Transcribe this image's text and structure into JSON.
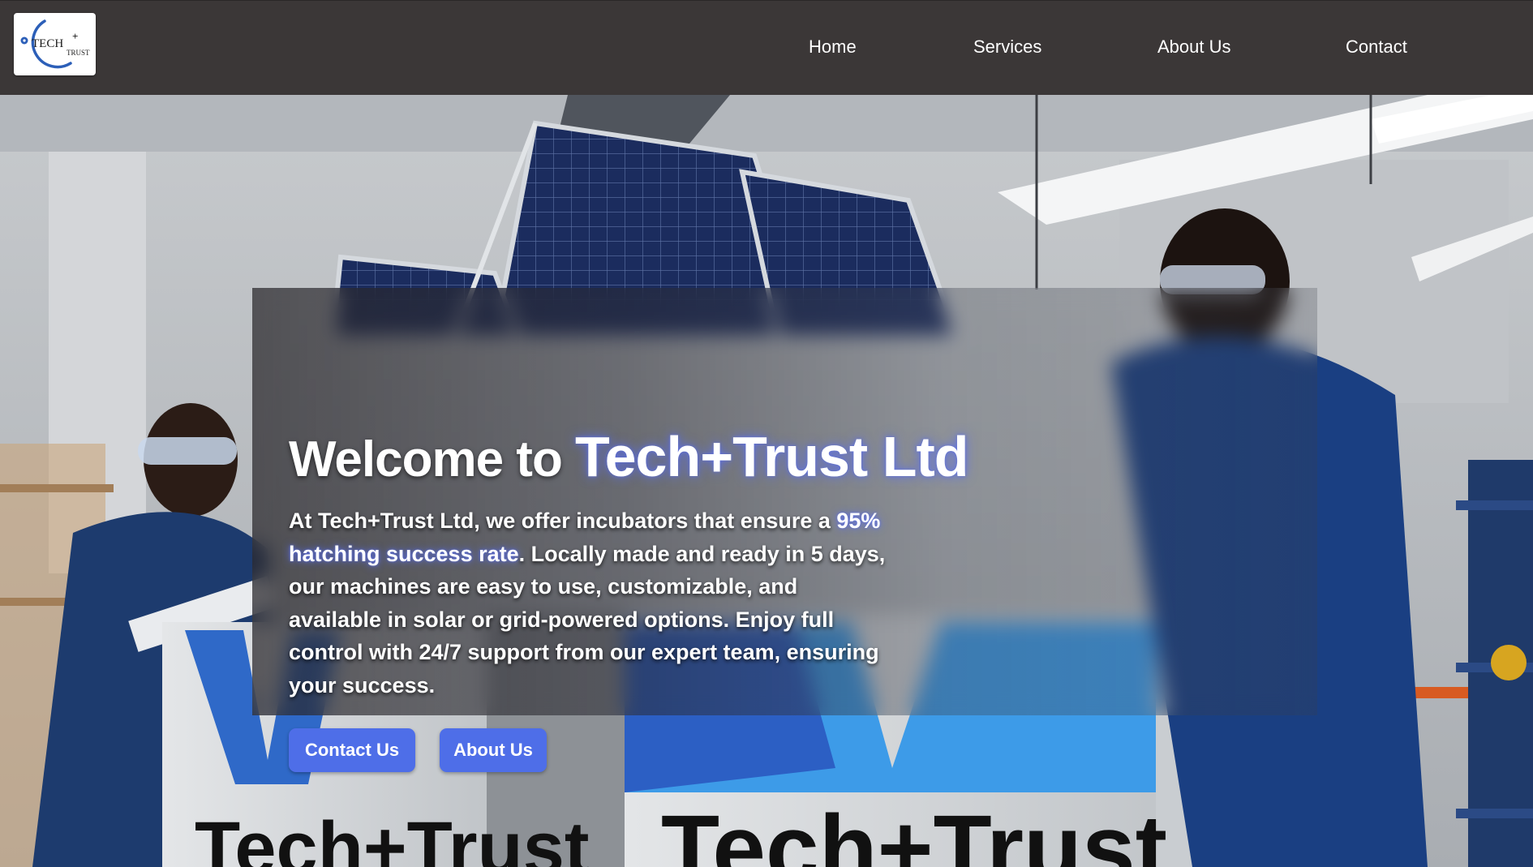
{
  "logo": {
    "word_main": "TECH",
    "word_plus": "+",
    "word_sub": "TRUST"
  },
  "nav": {
    "items": [
      {
        "label": "Home"
      },
      {
        "label": "Services"
      },
      {
        "label": "About Us"
      },
      {
        "label": "Contact"
      }
    ]
  },
  "hero": {
    "title_prefix": "Welcome to ",
    "title_brand": "Tech+Trust Ltd",
    "paragraph_intro": "At Tech+Trust Ltd, we offer incubators that ensure a ",
    "paragraph_highlight": "95% hatching success rate",
    "paragraph_rest": ". Locally made and ready in 5 days, our machines are easy to use, customizable, and available in solar or grid-powered options. Enjoy full control with 24/7 support from our expert team, ensuring your success.",
    "buttons": {
      "contact_label": "Contact Us",
      "about_label": "About Us"
    },
    "background_sign_text": "Tech+Trust"
  },
  "colors": {
    "navbar_bg": "#3b3737",
    "accent": "#4e6ee8",
    "brand_glow": "#5a6ef0",
    "text": "#ffffff"
  }
}
